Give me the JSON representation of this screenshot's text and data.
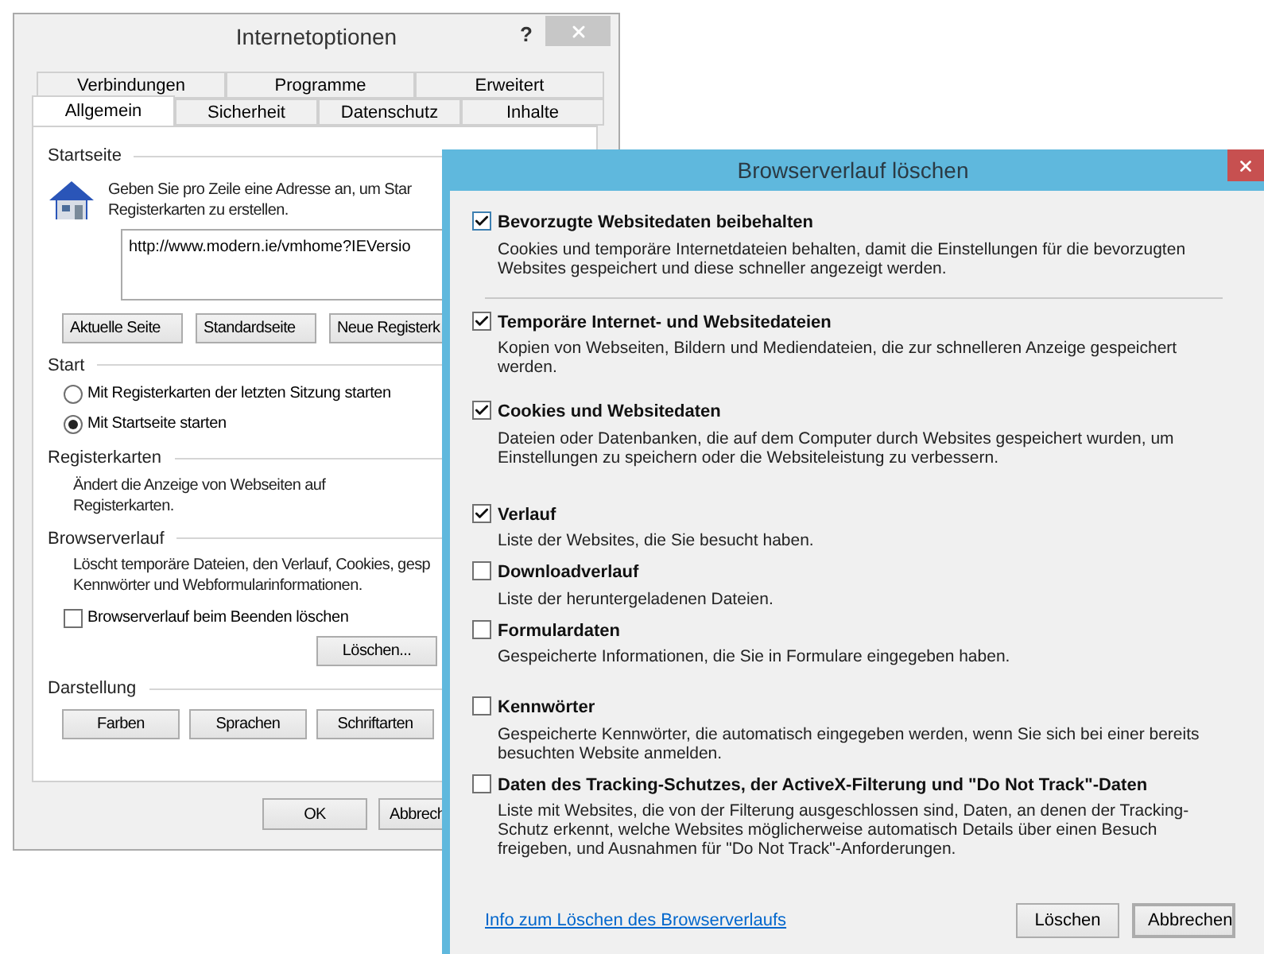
{
  "main_window": {
    "title": "Internetoptionen",
    "help": "?",
    "tabs_upper_row": [
      {
        "label": "Verbindungen",
        "selected": false
      },
      {
        "label": "Programme",
        "selected": false
      },
      {
        "label": "Erweitert",
        "selected": false
      }
    ],
    "tabs_lower_row": [
      {
        "label": "Allgemein",
        "selected": true
      },
      {
        "label": "Sicherheit",
        "selected": false
      },
      {
        "label": "Datenschutz",
        "selected": false
      },
      {
        "label": "Inhalte",
        "selected": false
      }
    ],
    "startseite": {
      "heading": "Startseite",
      "description_lines": [
        "Geben Sie pro Zeile eine Adresse an, um Star",
        "Registerkarten zu erstellen."
      ],
      "url": "http://www.modern.ie/vmhome?IEVersio",
      "buttons": [
        "Aktuelle Seite",
        "Standardseite",
        "Neue Registerk"
      ]
    },
    "start": {
      "heading": "Start",
      "options": [
        {
          "label": "Mit Registerkarten der letzten Sitzung starten",
          "selected": false
        },
        {
          "label": "Mit Startseite starten",
          "selected": true
        }
      ]
    },
    "registerkarten": {
      "heading": "Registerkarten",
      "description_lines": [
        "Ändert die Anzeige von Webseiten auf",
        "Registerkarten."
      ]
    },
    "browserverlauf": {
      "heading": "Browserverlauf",
      "description_lines": [
        "Löscht temporäre Dateien, den Verlauf, Cookies, gesp",
        "Kennwörter und Webformularinformationen."
      ],
      "checkbox": {
        "label": "Browserverlauf beim Beenden löschen",
        "checked": false
      },
      "button": "Löschen..."
    },
    "darstellung": {
      "heading": "Darstellung",
      "buttons": [
        "Farben",
        "Sprachen",
        "Schriftarten"
      ]
    },
    "footer_buttons": [
      "OK",
      "Abbrech"
    ]
  },
  "delete_dialog": {
    "title": "Browserverlauf löschen",
    "items": [
      {
        "label": "Bevorzugte Websitedaten beibehalten",
        "description": "Cookies und temporäre Internetdateien behalten, damit die Einstellungen für die bevorzugten Websites gespeichert und diese schneller angezeigt werden.",
        "checked": true
      },
      {
        "label": "Temporäre Internet- und Websitedateien",
        "description": "Kopien von Webseiten, Bildern und Mediendateien, die zur schnelleren Anzeige gespeichert werden.",
        "checked": true
      },
      {
        "label": "Cookies und Websitedaten",
        "description": "Dateien oder Datenbanken, die auf dem Computer durch Websites gespeichert wurden, um Einstellungen zu speichern oder die Websiteleistung zu verbessern.",
        "checked": true
      },
      {
        "label": "Verlauf",
        "description": "Liste der Websites, die Sie besucht haben.",
        "checked": true
      },
      {
        "label": "Downloadverlauf",
        "description": "Liste der heruntergeladenen Dateien.",
        "checked": false
      },
      {
        "label": "Formulardaten",
        "description": "Gespeicherte Informationen, die Sie in Formulare eingegeben haben.",
        "checked": false
      },
      {
        "label": "Kennwörter",
        "description": "Gespeicherte Kennwörter, die automatisch eingegeben werden, wenn Sie sich bei einer bereits besuchten Website anmelden.",
        "checked": false
      },
      {
        "label": "Daten des Tracking-Schutzes, der ActiveX-Filterung und \"Do Not Track\"-Daten",
        "description": "Liste mit Websites, die von der Filterung ausgeschlossen sind, Daten, an denen der Tracking-Schutz erkennt, welche Websites möglicherweise automatisch Details über einen Besuch freigeben, und Ausnahmen für \"Do Not Track\"-Anforderungen.",
        "checked": false
      }
    ],
    "link": "Info zum Löschen des Browserverlaufs",
    "buttons": [
      {
        "label": "Löschen",
        "default": false
      },
      {
        "label": "Abbrechen",
        "default": true
      }
    ]
  }
}
